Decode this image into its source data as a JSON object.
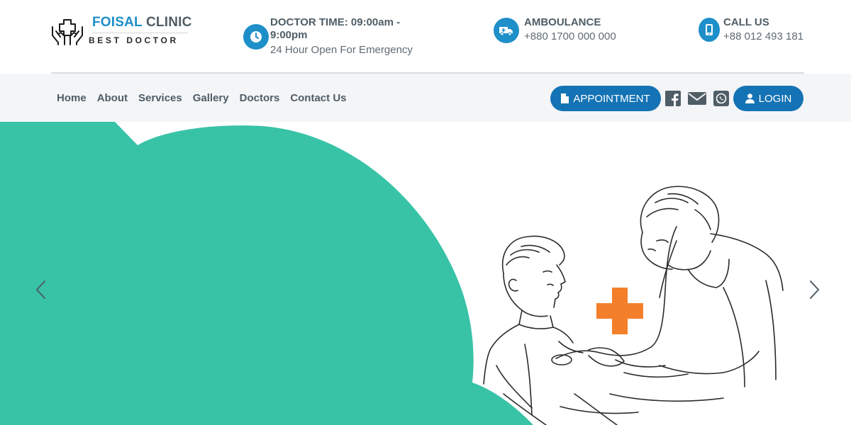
{
  "brand": {
    "name_part1": "FOISAL",
    "name_part2": "CLINIC",
    "tagline": "BEST DOCTOR",
    "icon": "hands-medical-cross-icon"
  },
  "contact_info": [
    {
      "icon": "clock-icon",
      "title_line1": "DOCTOR TIME: 09:00am -",
      "title_line2": "9:00pm",
      "subtitle": "24 Hour Open For Emergency"
    },
    {
      "icon": "ambulance-icon",
      "title_line1": "AMBOULANCE",
      "subtitle": "+880 1700 000 000"
    },
    {
      "icon": "mobile-phone-icon",
      "title_line1": "CALL US",
      "subtitle": "+88 012 493 181"
    }
  ],
  "nav": {
    "links": [
      "Home",
      "About",
      "Services",
      "Gallery",
      "Doctors",
      "Contact Us"
    ],
    "appointment_label": "APPOINTMENT",
    "login_label": "LOGIN",
    "social_icons": [
      "facebook-icon",
      "envelope-icon",
      "whatsapp-icon"
    ]
  },
  "colors": {
    "primary_blue": "#1e8fc9",
    "button_blue": "#1473b5",
    "hero_green": "#38c3a7",
    "medical_cross": "#f47f2a",
    "text_gray": "#4f5d66"
  },
  "carousel": {
    "prev_icon": "chevron-left-icon",
    "next_icon": "chevron-right-icon",
    "image": "doctor-examining-boy-illustration"
  }
}
